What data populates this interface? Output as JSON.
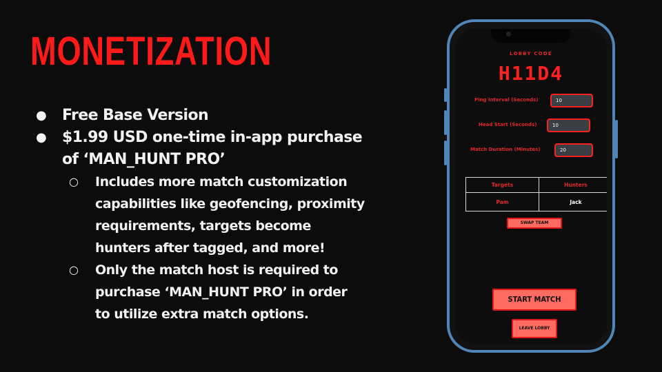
{
  "slide": {
    "title": "MONETIZATION",
    "bullets": [
      {
        "level": 1,
        "text": "Free Base Version"
      },
      {
        "level": 1,
        "text": "$1.99 USD one-time in-app purchase"
      },
      {
        "level": 1,
        "text": "of ‘MAN_HUNT PRO’",
        "continuation": true
      },
      {
        "level": 2,
        "text": "Includes more match customization"
      },
      {
        "level": 2,
        "text": "capabilities like geofencing, proximity",
        "continuation": true
      },
      {
        "level": 2,
        "text": "requirements, targets become",
        "continuation": true
      },
      {
        "level": 2,
        "text": "hunters after tagged, and more!",
        "continuation": true
      },
      {
        "level": 2,
        "text": "Only the match host is required to"
      },
      {
        "level": 2,
        "text": "purchase ‘MAN_HUNT PRO’ in order",
        "continuation": true
      },
      {
        "level": 2,
        "text": "to utilize extra match options.",
        "continuation": true
      }
    ],
    "bullet_symbols": {
      "level1": "●",
      "level2": "○"
    }
  },
  "phone": {
    "lobby_label": "LOBBY CODE",
    "lobby_code": "H11D4",
    "fields": {
      "ping_interval": {
        "label": "Ping Interval (Seconds)",
        "value": "10"
      },
      "head_start": {
        "label": "Head Start (Seconds)",
        "value": "10"
      },
      "match_duration": {
        "label": "Match Duration (Minutes)",
        "value": "20"
      }
    },
    "teams": {
      "headers": {
        "targets": "Targets",
        "hunters": "Hunters"
      },
      "targets": [
        "Pam"
      ],
      "hunters": [
        "Jack"
      ]
    },
    "buttons": {
      "swap_team": "SWAP TEAM",
      "start_match": "START MATCH",
      "leave_lobby": "LEAVE LOBBY"
    }
  },
  "colors": {
    "accent_red": "#ff1a1a",
    "button_fill": "#ff6b61",
    "phone_frame": "#4f86b5",
    "background": "#0c0c0c"
  }
}
